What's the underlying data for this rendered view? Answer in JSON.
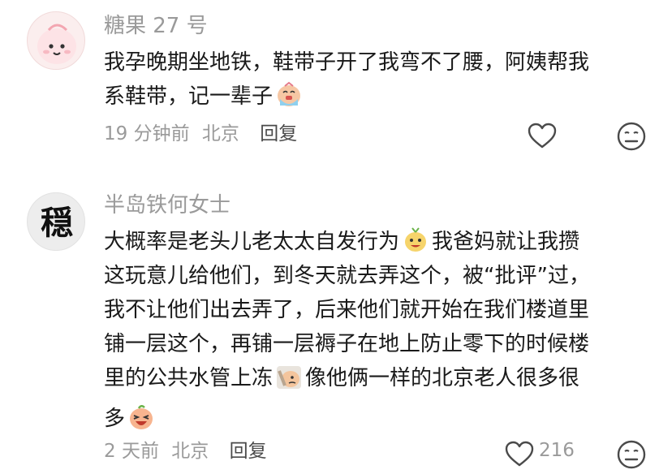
{
  "comments": [
    {
      "username": "糖果 27 号",
      "lines": [
        {
          "a": "我孕晚期坐地铁，鞋带子开了我弯不了腰，阿姨帮我",
          "b": ""
        },
        {
          "a": "系鞋带，记一辈子",
          "b": ""
        }
      ],
      "time": "19 分钟前",
      "location": "北京",
      "reply_label": "回复"
    },
    {
      "username": "半岛铁何女士",
      "avatar_text": "穏",
      "lines": [
        {
          "a": "大概率是老头儿老太太自发行为",
          "b": "我爸妈就让我攒"
        },
        {
          "a": "这玩意儿给他们，到冬天就去弄这个，被“批评”过，",
          "b": ""
        },
        {
          "a": "我不让他们出去弄了，后来他们就开始在我们楼道里",
          "b": ""
        },
        {
          "a": "铺一层这个，再铺一层褥子在地上防止零下的时候楼",
          "b": ""
        },
        {
          "a": "里的公共水管上冻",
          "b": "像他俩一样的北京老人很多很"
        },
        {
          "a": "多",
          "b": ""
        }
      ],
      "time": "2 天前",
      "location": "北京",
      "reply_label": "回复",
      "like_count": "216"
    }
  ],
  "icons": {
    "like": "heart-outline-icon",
    "dislike": "neutral-face-icon",
    "emoji_cry": "crying-face-sticker",
    "emoji_grin": "smug-face-sticker",
    "emoji_facepalm": "facepalm-sticker",
    "emoji_laugh": "laughing-face-sticker"
  },
  "colors": {
    "text": "#1a1a1a",
    "meta": "#9a9a9a",
    "reply": "#4a4a4a"
  }
}
